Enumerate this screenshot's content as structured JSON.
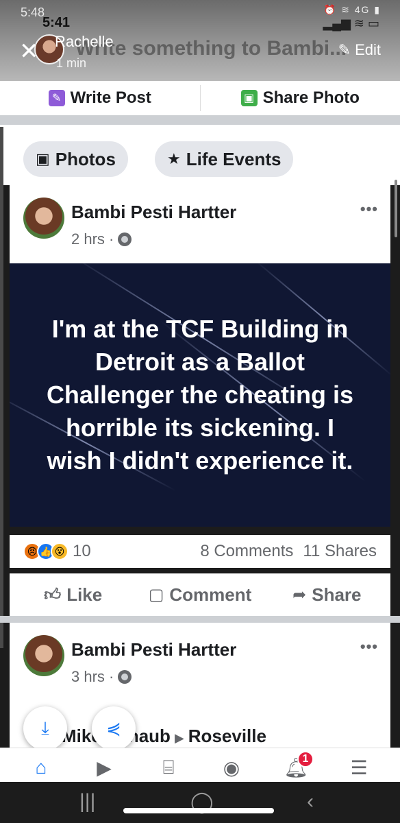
{
  "outer_status": {
    "time": "5:48",
    "signal": "4G"
  },
  "inner_status": {
    "time": "5:41"
  },
  "story_header": {
    "name": "Rachelle",
    "time": "1 min",
    "edit_label": "Edit",
    "ghost_prompt": "Write something to Bambi..."
  },
  "composer": {
    "write_post": "Write Post",
    "share_photo": "Share Photo"
  },
  "chips": [
    {
      "label": "Photos"
    },
    {
      "label": "Life Events"
    }
  ],
  "post1": {
    "author": "Bambi Pesti Hartter",
    "time": "2 hrs ·",
    "image_text": "I'm at the TCF Building in Detroit as a Ballot Challenger the cheating is horrible its sickening. I wish I didn't experience it.",
    "reaction_count": "10",
    "comments": "8 Comments",
    "shares": "11 Shares",
    "actions": {
      "like": "Like",
      "comment": "Comment",
      "share": "Share"
    }
  },
  "post2": {
    "author": "Bambi Pesti Hartter",
    "time": "3 hrs ·",
    "shared_from": "Mike Schaub",
    "shared_to": "Roseville"
  },
  "tabbar": {
    "notification_badge": "1"
  },
  "colors": {
    "accent": "#1877f2",
    "image_bg": "#101733",
    "badge": "#e41e3f"
  }
}
